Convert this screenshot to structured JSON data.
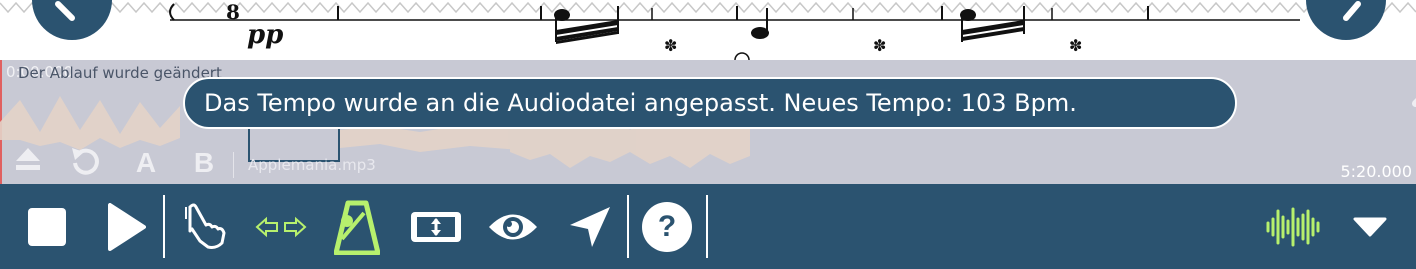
{
  "score": {
    "dynamic_marking": "pp",
    "measure_number": "8"
  },
  "waveform": {
    "time_start": "0:00.000",
    "time_end": "5:20.000",
    "flow_message": "Der Ablauf wurde geändert",
    "file_name": "Applemania.mp3",
    "buttons": [
      "eject-icon",
      "rewind-icon",
      "A",
      "B"
    ],
    "button_a_label": "A",
    "button_b_label": "B"
  },
  "toast": {
    "message": "Das Tempo wurde an die Audiodatei angepasst. Neues Tempo: 103 Bpm."
  },
  "toolbar": {
    "icons": [
      "stop-icon",
      "play-icon",
      "hand-tap-icon",
      "arrows-sync-icon",
      "metronome-icon",
      "fit-screen-icon",
      "eye-icon",
      "navigate-icon",
      "help-icon",
      "audio-wave-icon",
      "dropdown-icon"
    ],
    "help_label": "?"
  },
  "colors": {
    "toolbar_bg": "#2b5370",
    "accent_green": "#b7f06d",
    "waveform_bg": "#c8c9d4"
  }
}
